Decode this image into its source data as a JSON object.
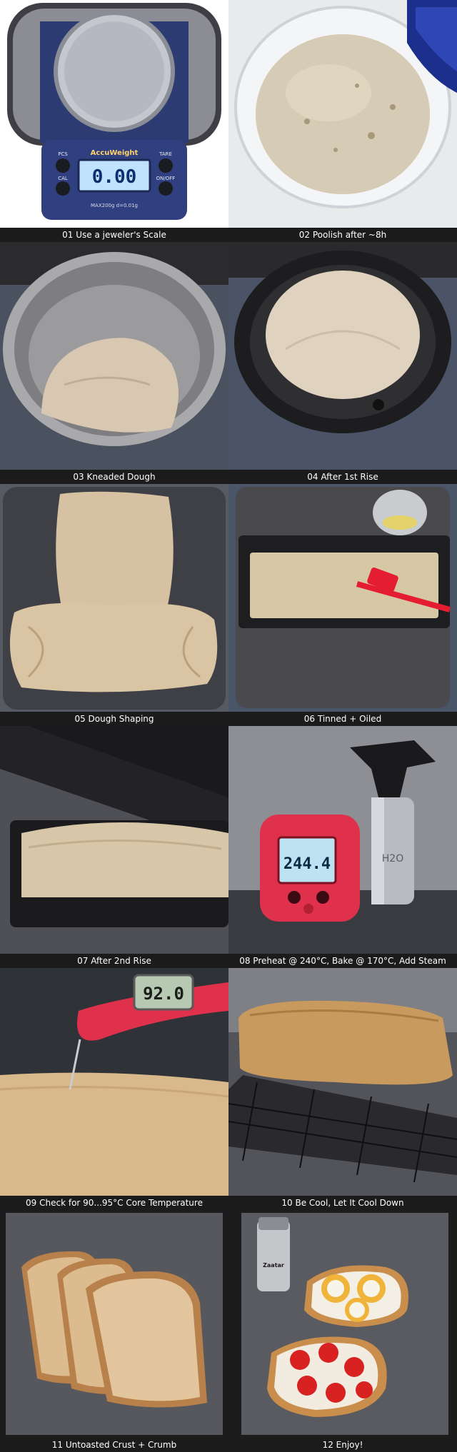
{
  "panels": [
    {
      "caption": "01 Use a jeweler's Scale",
      "scale_brand": "AccuWeight",
      "scale_display": "0.00",
      "scale_buttons": [
        "PCS",
        "CAL",
        "TARE",
        "ON/OFF"
      ],
      "scale_spec": "MAX200g d=0.01g"
    },
    {
      "caption": "02 Poolish after ~8h"
    },
    {
      "caption": "03 Kneaded Dough"
    },
    {
      "caption": "04 After 1st Rise"
    },
    {
      "caption": "05 Dough Shaping"
    },
    {
      "caption": "06 Tinned + Oiled"
    },
    {
      "caption": "07 After 2nd Rise"
    },
    {
      "caption": "08 Preheat @ 240°C, Bake @ 170°C, Add Steam",
      "thermometer_display": "244.4",
      "bottle_label": "H2O"
    },
    {
      "caption": "09 Check for 90...95°C Core Temperature",
      "probe_display": "92.0"
    },
    {
      "caption": "10 Be Cool, Let It Cool Down"
    },
    {
      "caption": "11 Untoasted Crust + Crumb"
    },
    {
      "caption": "12 Enjoy!",
      "jar_label": "Zaatar"
    }
  ],
  "colors": {
    "background": "#1e1e1e",
    "caption_text": "#ffffff",
    "dough": "#d9cbb3",
    "crust": "#c99a5e",
    "thermometer_red": "#e0314c"
  }
}
